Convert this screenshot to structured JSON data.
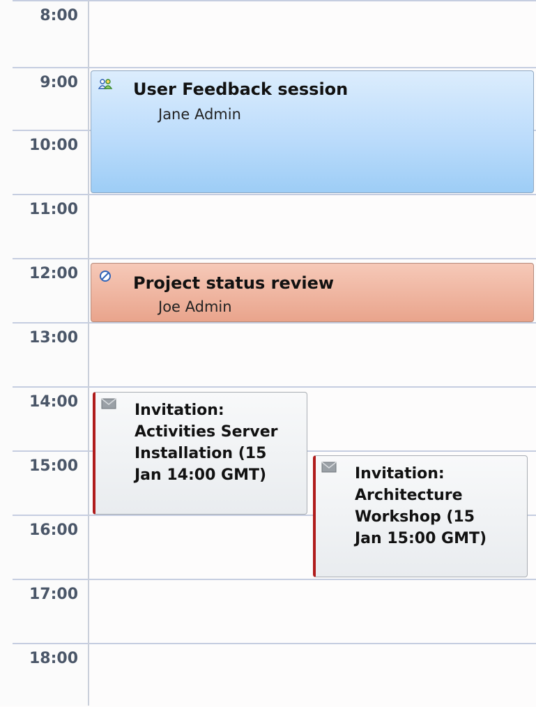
{
  "hours": [
    "8:00",
    "9:00",
    "10:00",
    "11:00",
    "12:00",
    "13:00",
    "14:00",
    "15:00",
    "16:00",
    "17:00",
    "18:00"
  ],
  "events": [
    {
      "title": "User Feedback session",
      "organizer": "Jane Admin",
      "icon": "meeting-icon",
      "color": "#bcdcfb"
    },
    {
      "title": "Project status review",
      "organizer": "Joe Admin",
      "icon": "recurring-icon",
      "color": "#e9a48c"
    },
    {
      "title": "Invitation:\nActivities Server\nInstallation (15\nJan 14:00 GMT)",
      "icon": "envelope-icon",
      "color": "#eef0f2"
    },
    {
      "title": "Invitation:\nArchitecture\nWorkshop (15\nJan 15:00 GMT)",
      "icon": "envelope-icon",
      "color": "#eef0f2"
    }
  ]
}
